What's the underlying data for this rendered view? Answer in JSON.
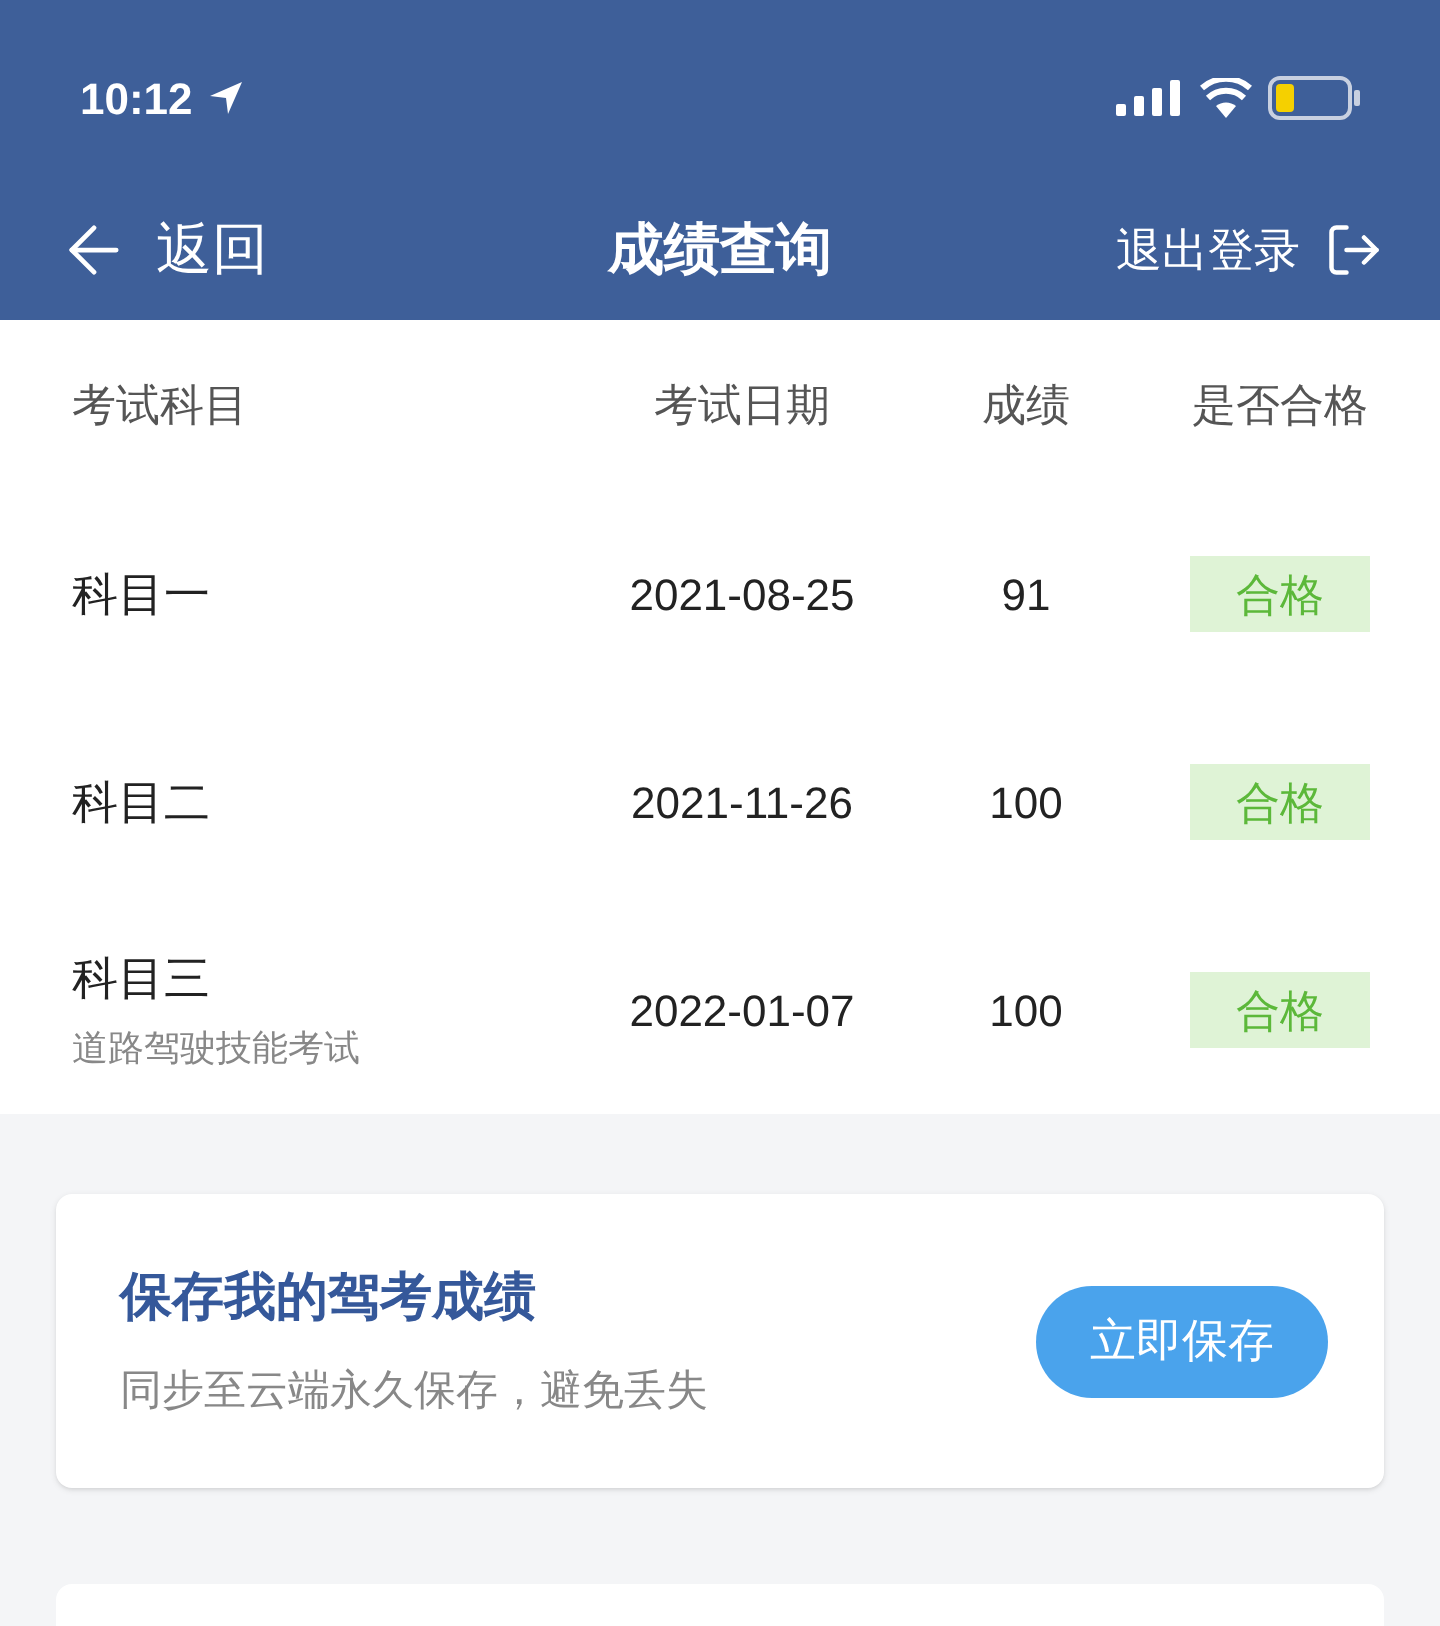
{
  "status_bar": {
    "time": "10:12"
  },
  "nav": {
    "back": "返回",
    "title": "成绩查询",
    "logout": "退出登录"
  },
  "table": {
    "columns": [
      "考试科目",
      "考试日期",
      "成绩",
      "是否合格"
    ],
    "rows": [
      {
        "subject": "科目一",
        "date": "2021-08-25",
        "score": "91",
        "result": "合格",
        "passed": true
      },
      {
        "subject": "科目二",
        "date": "2021-11-26",
        "score": "100",
        "result": "合格",
        "passed": true
      },
      {
        "subject": "科目三",
        "note": "道路驾驶技能考试",
        "date": "2022-01-07",
        "score": "100",
        "result": "合格",
        "passed": true
      }
    ]
  },
  "save_card": {
    "title": "保存我的驾考成绩",
    "subtitle": "同步至云端永久保存，避免丢失",
    "button": "立即保存"
  }
}
